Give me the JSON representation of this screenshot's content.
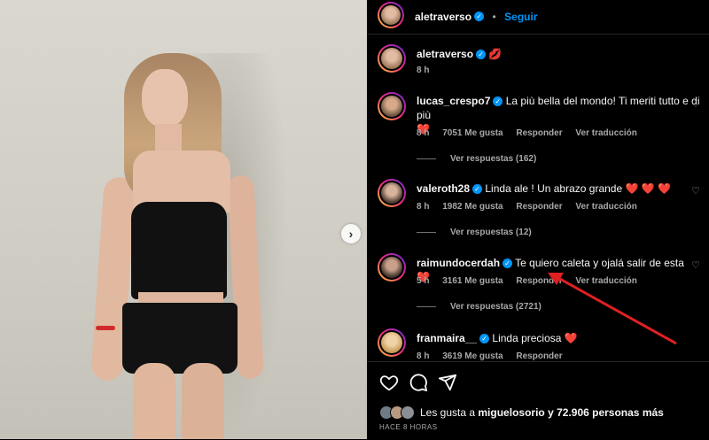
{
  "post": {
    "author": "aletraverso",
    "follow_label": "Seguir",
    "caption_emoji": "💋",
    "caption_time": "8 h",
    "next_icon": "chevron-right-icon"
  },
  "comments": [
    {
      "username": "lucas_crespo7",
      "verified": true,
      "text": "La più bella del mondo! Ti meriti tutto e di più",
      "emoji": "❤️",
      "time": "8 h",
      "likes": "7051 Me gusta",
      "reply": "Responder",
      "translate": "Ver traducción",
      "replies": "Ver respuestas (162)"
    },
    {
      "username": "valeroth28",
      "verified": true,
      "text": "Linda ale ! Un abrazo grande",
      "emoji": "❤️ ❤️ ❤️",
      "time": "8 h",
      "likes": "1982 Me gusta",
      "reply": "Responder",
      "translate": "Ver traducción",
      "replies": "Ver respuestas (12)"
    },
    {
      "username": "raimundocerdah",
      "verified": true,
      "text": "Te quiero caleta y ojalá salir de esta",
      "emoji": "❤️",
      "time": "5 h",
      "likes": "3161 Me gusta",
      "reply": "Responder",
      "translate": "Ver traducción",
      "replies": "Ver respuestas (2721)"
    },
    {
      "username": "franmaira__",
      "verified": true,
      "text": "Linda preciosa",
      "emoji": "❤️",
      "time": "8 h",
      "likes": "3619 Me gusta",
      "reply": "Responder",
      "translate": "",
      "replies": ""
    }
  ],
  "actions": {
    "like_icon": "heart-icon",
    "comment_icon": "comment-icon",
    "share_icon": "send-icon"
  },
  "likes_summary": {
    "prefix": "Les gusta a ",
    "user": "miguelosorio",
    "suffix": " y 72.906 personas más"
  },
  "timestamp": "HACE 8 HORAS",
  "colors": {
    "accent": "#0095f6",
    "heart": "#ff3040",
    "annotation_arrow": "#e02020",
    "background": "#000000"
  }
}
